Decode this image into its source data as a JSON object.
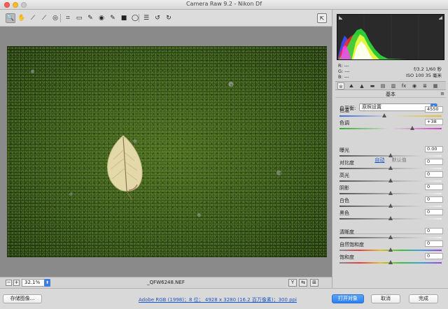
{
  "window": {
    "title": "Camera Raw 9.2 -  Nikon Df"
  },
  "toolbar": {
    "tools": [
      {
        "name": "zoom-tool-icon",
        "glyph": "🔍"
      },
      {
        "name": "hand-tool-icon",
        "glyph": "✋"
      },
      {
        "name": "white-balance-tool-icon",
        "glyph": "⟋"
      },
      {
        "name": "color-sampler-tool-icon",
        "glyph": "⟋"
      },
      {
        "name": "targeted-adjustment-tool-icon",
        "glyph": "◎"
      },
      {
        "name": "crop-tool-icon",
        "glyph": "⌗"
      },
      {
        "name": "straighten-tool-icon",
        "glyph": "▭"
      },
      {
        "name": "spot-removal-tool-icon",
        "glyph": "✎"
      },
      {
        "name": "red-eye-tool-icon",
        "glyph": "◉"
      },
      {
        "name": "adjustment-brush-icon",
        "glyph": "✎"
      },
      {
        "name": "graduated-filter-icon",
        "glyph": "■"
      },
      {
        "name": "radial-filter-icon",
        "glyph": "◯"
      },
      {
        "name": "preferences-icon",
        "glyph": "☰"
      },
      {
        "name": "rotate-ccw-icon",
        "glyph": "↺"
      },
      {
        "name": "rotate-cw-icon",
        "glyph": "↻"
      }
    ],
    "fullscreen_glyph": "⇱"
  },
  "canvas": {
    "zoom_out": "−",
    "zoom_in": "+",
    "zoom_value": "32.1%",
    "filename": "_QFW6248.NEF",
    "view_buttons": [
      "Y",
      "⇆",
      "⊞"
    ]
  },
  "info": {
    "r": "R:   ---",
    "g": "G:   ---",
    "b": "B:   ---",
    "aperture_shutter": "f/3.2   1/60 秒",
    "iso_focal": "ISO 100   35 毫米"
  },
  "panel_tabs": [
    "⊛",
    "⛰",
    "▲",
    "▬",
    "▤",
    "▥",
    "fx",
    "◉",
    "≣",
    "▦"
  ],
  "panel": {
    "section_title": "基本",
    "menu_glyph": "≡",
    "white_balance_label": "白平衡:",
    "white_balance_value": "原照设置",
    "auto_label": "自动",
    "default_label": "默认值"
  },
  "sliders": [
    {
      "label": "色温",
      "value": "4550",
      "pos": 0.44,
      "track": "temp"
    },
    {
      "label": "色调",
      "value": "+38",
      "pos": 0.71,
      "track": "tint"
    },
    {
      "label": "曝光",
      "value": "0.00",
      "pos": 0.5,
      "track": "plain"
    },
    {
      "label": "对比度",
      "value": "0",
      "pos": 0.5,
      "track": "plain"
    },
    {
      "label": "高光",
      "value": "0",
      "pos": 0.5,
      "track": "plain"
    },
    {
      "label": "阴影",
      "value": "0",
      "pos": 0.5,
      "track": "plain"
    },
    {
      "label": "白色",
      "value": "0",
      "pos": 0.5,
      "track": "plain"
    },
    {
      "label": "黑色",
      "value": "0",
      "pos": 0.5,
      "track": "plain"
    },
    {
      "label": "清晰度",
      "value": "0",
      "pos": 0.5,
      "track": "plain"
    },
    {
      "label": "自然饱和度",
      "value": "0",
      "pos": 0.5,
      "track": "rainbow"
    },
    {
      "label": "饱和度",
      "value": "0",
      "pos": 0.5,
      "track": "rainbow"
    }
  ],
  "footer": {
    "save_label": "存储图像...",
    "workflow_label": "Adobe RGB (1998)；8 位； 4928 x 3280 (16.2 百万像素)；300 ppi",
    "open_label": "打开对象",
    "cancel_label": "取消",
    "done_label": "完成"
  },
  "colors": {
    "accent": "#2a7ff0",
    "link": "#1a55c8"
  }
}
